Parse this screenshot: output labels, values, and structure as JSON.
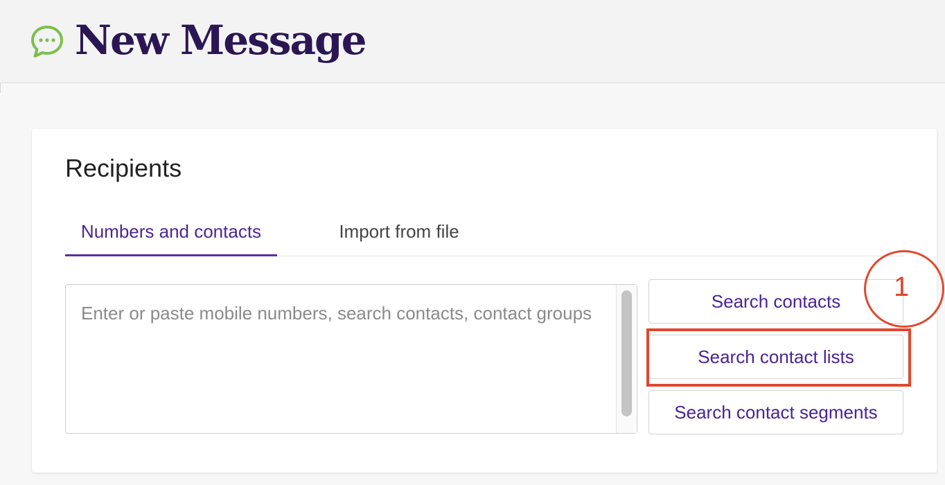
{
  "header": {
    "title": "New Message",
    "icon": "chat-bubble-icon",
    "icon_color": "#7cbf4e",
    "title_color": "#2b1654"
  },
  "recipients": {
    "title": "Recipients",
    "tabs": [
      {
        "label": "Numbers and contacts",
        "active": true
      },
      {
        "label": "Import from file",
        "active": false
      }
    ],
    "input": {
      "placeholder": "Enter or paste mobile numbers, search contacts, contact groups",
      "value": ""
    },
    "buttons": {
      "search_contacts": "Search contacts",
      "search_contact_lists": "Search contact lists",
      "search_contact_segments": "Search contact segments"
    }
  },
  "annotation": {
    "step_label": "1",
    "color": "#e0472e"
  },
  "colors": {
    "accent": "#5b2da6",
    "button_text": "#4b2295"
  }
}
